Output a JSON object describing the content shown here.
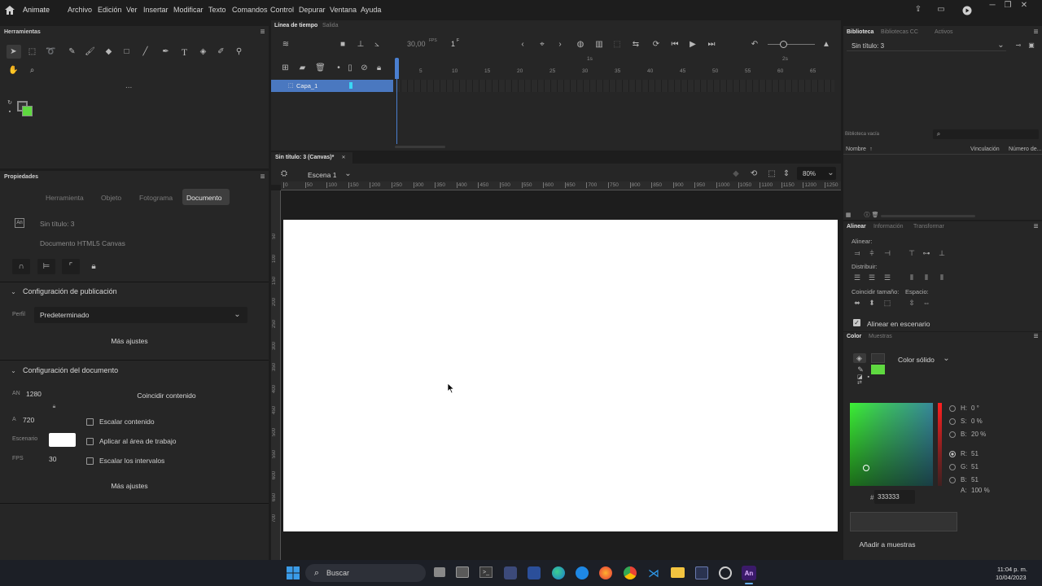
{
  "app": {
    "name": "Animate"
  },
  "menu": [
    "Archivo",
    "Edición",
    "Ver",
    "Insertar",
    "Modificar",
    "Texto",
    "Comandos",
    "Control",
    "Depurar",
    "Ventana",
    "Ayuda"
  ],
  "tools": {
    "title": "Herramientas",
    "more": "..."
  },
  "timeline": {
    "tabs": [
      "Línea de tiempo",
      "Salida"
    ],
    "fps": "30,00",
    "fps_unit": "FPS",
    "frame": "1",
    "frame_unit": "F",
    "layer": "Capa_1",
    "ruler": [
      "5",
      "10",
      "15",
      "20",
      "25",
      "30",
      "35",
      "40",
      "45",
      "50",
      "55",
      "60",
      "65"
    ],
    "sec_marks": [
      "1s",
      "2s"
    ]
  },
  "canvas": {
    "tab": "Sin título: 3 (Canvas)*",
    "scene": "Escena 1",
    "zoom": "80%",
    "hruler": [
      "0",
      "50",
      "100",
      "150",
      "200",
      "250",
      "300",
      "350",
      "400",
      "450",
      "500",
      "550",
      "600",
      "650",
      "700",
      "750",
      "800",
      "850",
      "900",
      "950",
      "1000",
      "1050",
      "1100",
      "1150",
      "1200",
      "1250"
    ],
    "vruler": [
      "50",
      "100",
      "150",
      "200",
      "250",
      "300",
      "350",
      "400",
      "450",
      "500",
      "550",
      "600",
      "650",
      "700"
    ]
  },
  "properties": {
    "title": "Propiedades",
    "tabs": [
      "Herramienta",
      "Objeto",
      "Fotograma",
      "Documento"
    ],
    "doc_name": "Sin título: 3",
    "doc_type": "Documento HTML5 Canvas",
    "publish_section": "Configuración de publicación",
    "profile_label": "Perfil",
    "profile_value": "Predeterminado",
    "more_settings": "Más ajustes",
    "doc_section": "Configuración del documento",
    "width_label": "AN",
    "width": "1280",
    "height_label": "A",
    "height": "720",
    "match_content": "Coincidir contenido",
    "stage_label": "Escenario",
    "fps_label": "FPS",
    "fps": "30",
    "scale_content": "Escalar contenido",
    "apply_workarea": "Aplicar al área de trabajo",
    "scale_spans": "Escalar los intervalos",
    "more_settings2": "Más ajustes"
  },
  "library": {
    "tabs": [
      "Biblioteca",
      "Bibliotecas CC",
      "Activos"
    ],
    "doc": "Sin título: 3",
    "empty": "Biblioteca vacía",
    "col_name": "Nombre",
    "col_link": "Vinculación",
    "col_num": "Número de..."
  },
  "align": {
    "tabs": [
      "Alinear",
      "Información",
      "Transformar"
    ],
    "align_label": "Alinear:",
    "distribute_label": "Distribuir:",
    "match_size_label": "Coincidir tamaño:",
    "space_label": "Espacio:",
    "to_stage": "Alinear en escenario"
  },
  "color": {
    "tabs": [
      "Color",
      "Muestras"
    ],
    "fill_type": "Color sólido",
    "H": "0 °",
    "S": "0 %",
    "B": "20 %",
    "R": "51",
    "G": "51",
    "Bv": "51",
    "A": "100 %",
    "hex_label": "#",
    "hex": "333333",
    "add_swatch": "Añadir a muestras",
    "stroke_color": "#333333",
    "fill_color": "#5fd940"
  },
  "taskbar": {
    "search": "Buscar",
    "time": "11:04 p. m.",
    "date": "10/04/2023"
  }
}
